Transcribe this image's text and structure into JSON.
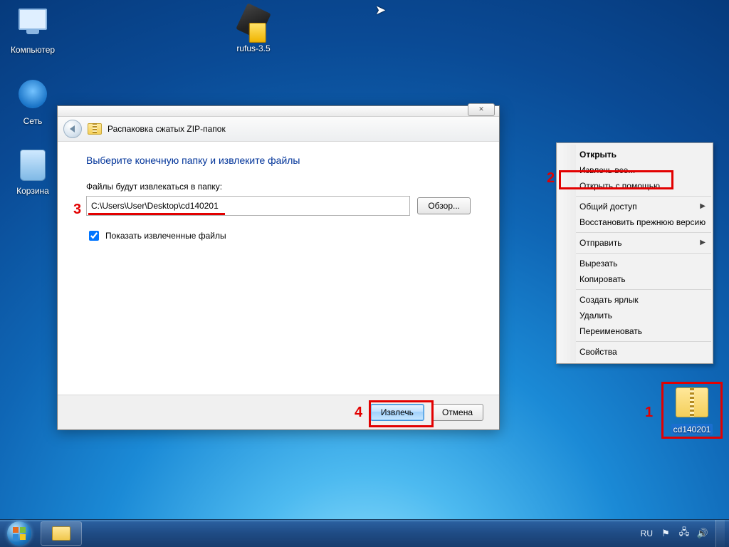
{
  "desktop_icons": {
    "computer": "Компьютер",
    "network": "Сеть",
    "recycle_bin": "Корзина",
    "rufus": "rufus-3.5",
    "zip_file": "cd140201"
  },
  "wizard": {
    "title": "Распаковка сжатых ZIP-папок",
    "heading": "Выберите конечную папку и извлеките файлы",
    "dest_label": "Файлы будут извлекаться в папку:",
    "path_value": "C:\\Users\\User\\Desktop\\cd140201",
    "browse_button": "Обзор...",
    "show_extracted_checkbox": "Показать извлеченные файлы",
    "show_extracted_checked": true,
    "extract_button": "Извлечь",
    "cancel_button": "Отмена",
    "close_glyph": "✕"
  },
  "context_menu": {
    "groups": [
      {
        "items": [
          {
            "label": "Открыть",
            "bold": true
          },
          {
            "label": "Извлечь все..."
          },
          {
            "label": "Открыть с помощью..."
          }
        ]
      },
      {
        "items": [
          {
            "label": "Общий доступ",
            "submenu": true
          },
          {
            "label": "Восстановить прежнюю версию"
          }
        ]
      },
      {
        "items": [
          {
            "label": "Отправить",
            "submenu": true
          }
        ]
      },
      {
        "items": [
          {
            "label": "Вырезать"
          },
          {
            "label": "Копировать"
          }
        ]
      },
      {
        "items": [
          {
            "label": "Создать ярлык"
          },
          {
            "label": "Удалить"
          },
          {
            "label": "Переименовать"
          }
        ]
      },
      {
        "items": [
          {
            "label": "Свойства"
          }
        ]
      }
    ]
  },
  "taskbar": {
    "language": "RU"
  },
  "annotations": {
    "1": "1",
    "2": "2",
    "3": "3",
    "4": "4"
  }
}
